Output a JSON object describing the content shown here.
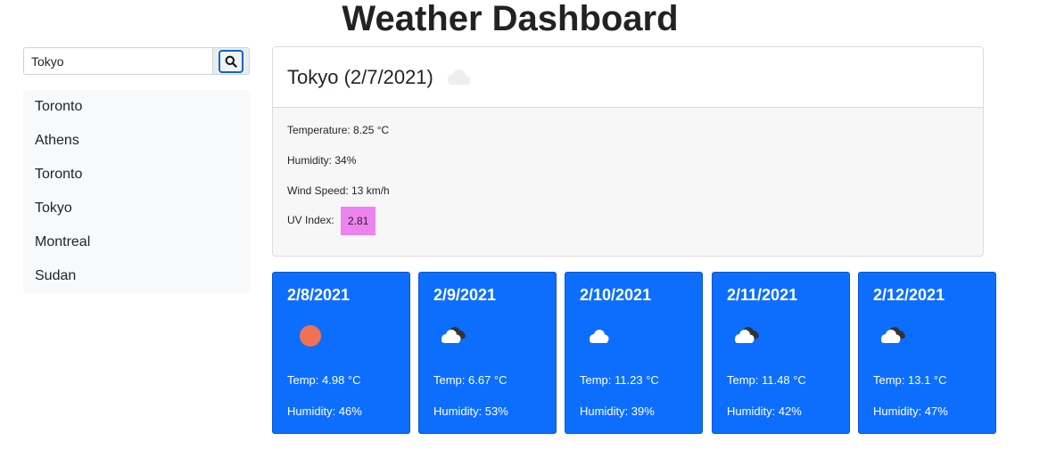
{
  "header": {
    "title": "Weather Dashboard"
  },
  "search": {
    "value": "Tokyo",
    "button_icon": "search-icon"
  },
  "history": {
    "items": [
      {
        "label": "Toronto"
      },
      {
        "label": "Athens"
      },
      {
        "label": "Toronto"
      },
      {
        "label": "Tokyo"
      },
      {
        "label": "Montreal"
      },
      {
        "label": "Sudan"
      }
    ]
  },
  "current": {
    "title": "Tokyo (2/7/2021)",
    "icon": "cloud-icon",
    "temperature": "Temperature: 8.25 °C",
    "humidity": "Humidity: 34%",
    "wind": "Wind Speed: 13 km/h",
    "uv_label": "UV Index:",
    "uv_value": "2.81",
    "uv_color": "#ee82ee"
  },
  "forecast": [
    {
      "date": "2/8/2021",
      "icon": "sun-icon",
      "temp": "Temp: 4.98 °C",
      "humidity": "Humidity: 46%"
    },
    {
      "date": "2/9/2021",
      "icon": "broken-clouds-icon",
      "temp": "Temp: 6.67 °C",
      "humidity": "Humidity: 53%"
    },
    {
      "date": "2/10/2021",
      "icon": "cloud-icon",
      "temp": "Temp: 11.23 °C",
      "humidity": "Humidity: 39%"
    },
    {
      "date": "2/11/2021",
      "icon": "broken-clouds-icon",
      "temp": "Temp: 11.48 °C",
      "humidity": "Humidity: 42%"
    },
    {
      "date": "2/12/2021",
      "icon": "broken-clouds-icon",
      "temp": "Temp: 13.1 °C",
      "humidity": "Humidity: 47%"
    }
  ],
  "colors": {
    "forecast_bg": "#0d6efd",
    "sun": "#f07153"
  }
}
